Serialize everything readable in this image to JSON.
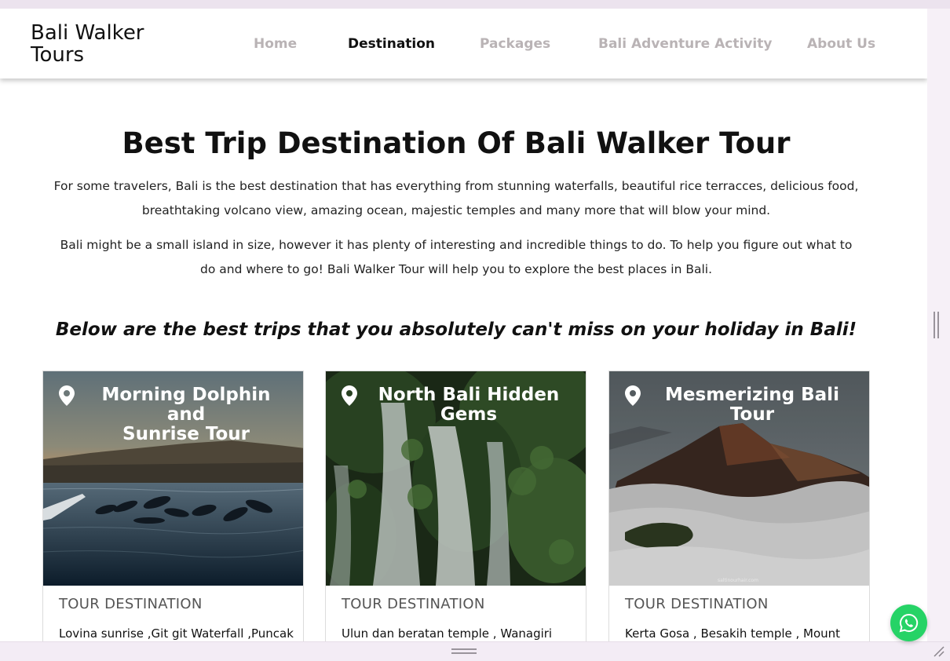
{
  "brand": {
    "line1": "Bali Walker",
    "line2": "Tours"
  },
  "nav": [
    {
      "label": "Home",
      "active": false
    },
    {
      "label": "Destination",
      "active": true
    },
    {
      "label": "Packages",
      "active": false
    },
    {
      "label": "Bali Adventure Activity",
      "active": false
    },
    {
      "label": "About Us",
      "active": false
    }
  ],
  "main": {
    "title": "Best Trip Destination Of Bali Walker Tour",
    "para1_line1": "For some travelers, Bali is the best destination that has everything from stunning waterfalls, beautiful rice terracces, delicious food,",
    "para1_line2": "breathtaking volcano view, amazing ocean, majestic temples and many more that will blow your mind.",
    "para2_line1": "Bali might be a small island in size, however it has plenty of interesting and incredible things to do. To help you figure out what to",
    "para2_line2": "do and where to go! Bali Walker Tour will help you to explore the best places in Bali.",
    "subtitle": "Below are the best trips that you absolutely can't miss on your holiday in Bali!"
  },
  "cards": [
    {
      "title_line1": "Morning Dolphin and",
      "title_line2": "Sunrise Tour",
      "label": "TOUR DESTINATION",
      "desc": "Lovina sunrise ,Git git Waterfall ,Puncak"
    },
    {
      "title_line1": "North Bali Hidden",
      "title_line2": "Gems",
      "label": "TOUR DESTINATION",
      "desc": "Ulun dan beratan temple , Wanagiri"
    },
    {
      "title_line1": "Mesmerizing Bali",
      "title_line2": "Tour",
      "label": "TOUR DESTINATION",
      "desc": "Kerta Gosa , Besakih temple , Mount",
      "watermark": "saltinourhair.com"
    }
  ],
  "icons": {
    "pin": "map-pin-icon",
    "whatsapp": "whatsapp-icon"
  },
  "colors": {
    "whatsapp": "#26d366",
    "nav_inactive": "#b9b3b5",
    "nav_active": "#111111"
  }
}
